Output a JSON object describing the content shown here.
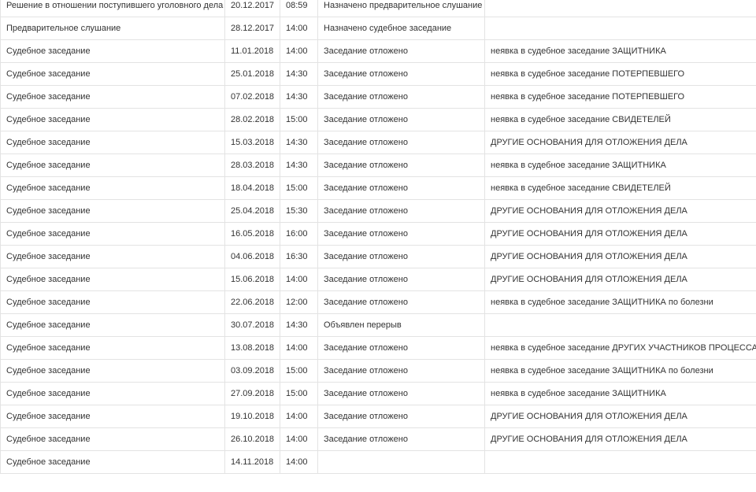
{
  "rows": [
    {
      "event": "Решение в отношении поступившего уголовного дела",
      "date": "20.12.2017",
      "time": "08:59",
      "result": "Назначено предварительное слушание",
      "reason": ""
    },
    {
      "event": "Предварительное слушание",
      "date": "28.12.2017",
      "time": "14:00",
      "result": "Назначено судебное заседание",
      "reason": ""
    },
    {
      "event": "Судебное заседание",
      "date": "11.01.2018",
      "time": "14:00",
      "result": "Заседание отложено",
      "reason": "неявка в судебное заседание ЗАЩИТНИКА"
    },
    {
      "event": "Судебное заседание",
      "date": "25.01.2018",
      "time": "14:30",
      "result": "Заседание отложено",
      "reason": "неявка в судебное заседание ПОТЕРПЕВШЕГО"
    },
    {
      "event": "Судебное заседание",
      "date": "07.02.2018",
      "time": "14:30",
      "result": "Заседание отложено",
      "reason": "неявка в судебное заседание ПОТЕРПЕВШЕГО"
    },
    {
      "event": "Судебное заседание",
      "date": "28.02.2018",
      "time": "15:00",
      "result": "Заседание отложено",
      "reason": "неявка в судебное заседание СВИДЕТЕЛЕЙ"
    },
    {
      "event": "Судебное заседание",
      "date": "15.03.2018",
      "time": "14:30",
      "result": "Заседание отложено",
      "reason": "ДРУГИЕ ОСНОВАНИЯ ДЛЯ ОТЛОЖЕНИЯ ДЕЛА"
    },
    {
      "event": "Судебное заседание",
      "date": "28.03.2018",
      "time": "14:30",
      "result": "Заседание отложено",
      "reason": "неявка в судебное заседание ЗАЩИТНИКА"
    },
    {
      "event": "Судебное заседание",
      "date": "18.04.2018",
      "time": "15:00",
      "result": "Заседание отложено",
      "reason": "неявка в судебное заседание СВИДЕТЕЛЕЙ"
    },
    {
      "event": "Судебное заседание",
      "date": "25.04.2018",
      "time": "15:30",
      "result": "Заседание отложено",
      "reason": "ДРУГИЕ ОСНОВАНИЯ ДЛЯ ОТЛОЖЕНИЯ ДЕЛА"
    },
    {
      "event": "Судебное заседание",
      "date": "16.05.2018",
      "time": "16:00",
      "result": "Заседание отложено",
      "reason": "ДРУГИЕ ОСНОВАНИЯ ДЛЯ ОТЛОЖЕНИЯ ДЕЛА"
    },
    {
      "event": "Судебное заседание",
      "date": "04.06.2018",
      "time": "16:30",
      "result": "Заседание отложено",
      "reason": "ДРУГИЕ ОСНОВАНИЯ ДЛЯ ОТЛОЖЕНИЯ ДЕЛА"
    },
    {
      "event": "Судебное заседание",
      "date": "15.06.2018",
      "time": "14:00",
      "result": "Заседание отложено",
      "reason": "ДРУГИЕ ОСНОВАНИЯ ДЛЯ ОТЛОЖЕНИЯ ДЕЛА"
    },
    {
      "event": "Судебное заседание",
      "date": "22.06.2018",
      "time": "12:00",
      "result": "Заседание отложено",
      "reason": "неявка в судебное заседание ЗАЩИТНИКА по болезни"
    },
    {
      "event": "Судебное заседание",
      "date": "30.07.2018",
      "time": "14:30",
      "result": "Объявлен перерыв",
      "reason": ""
    },
    {
      "event": "Судебное заседание",
      "date": "13.08.2018",
      "time": "14:00",
      "result": "Заседание отложено",
      "reason": "неявка в судебное заседание ДРУГИХ УЧАСТНИКОВ ПРОЦЕССА"
    },
    {
      "event": "Судебное заседание",
      "date": "03.09.2018",
      "time": "15:00",
      "result": "Заседание отложено",
      "reason": "неявка в судебное заседание ЗАЩИТНИКА по болезни"
    },
    {
      "event": "Судебное заседание",
      "date": "27.09.2018",
      "time": "15:00",
      "result": "Заседание отложено",
      "reason": "неявка в судебное заседание ЗАЩИТНИКА"
    },
    {
      "event": "Судебное заседание",
      "date": "19.10.2018",
      "time": "14:00",
      "result": "Заседание отложено",
      "reason": "ДРУГИЕ ОСНОВАНИЯ ДЛЯ ОТЛОЖЕНИЯ ДЕЛА"
    },
    {
      "event": "Судебное заседание",
      "date": "26.10.2018",
      "time": "14:00",
      "result": "Заседание отложено",
      "reason": "ДРУГИЕ ОСНОВАНИЯ ДЛЯ ОТЛОЖЕНИЯ ДЕЛА"
    },
    {
      "event": "Судебное заседание",
      "date": "14.11.2018",
      "time": "14:00",
      "result": "",
      "reason": ""
    }
  ]
}
